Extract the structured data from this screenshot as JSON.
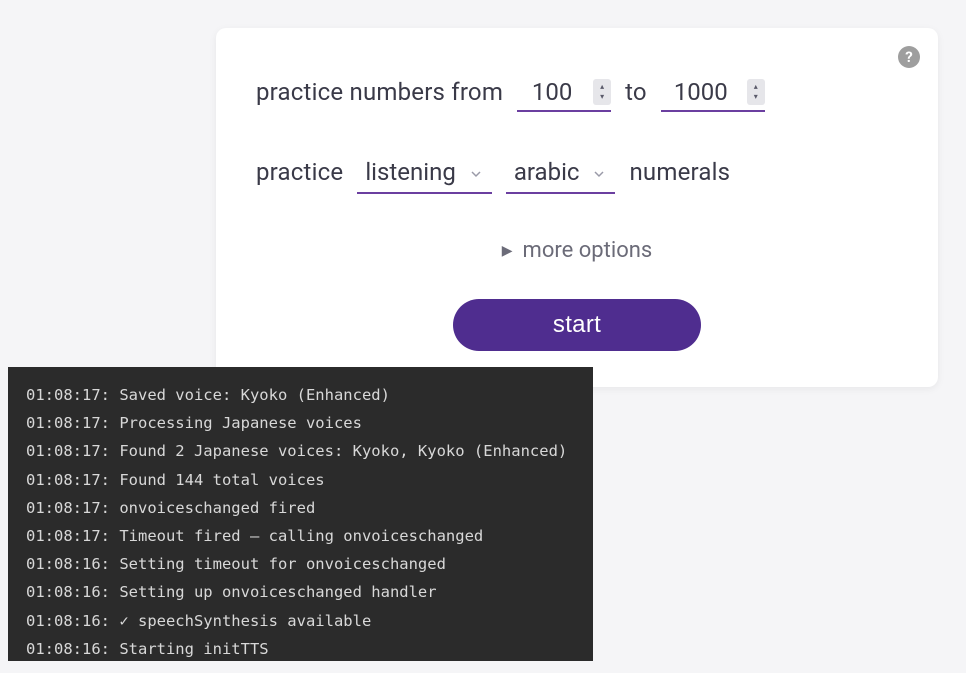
{
  "form": {
    "row1_prefix": "practice numbers from",
    "from_value": "100",
    "middle": "to",
    "to_value": "1000",
    "row2_prefix": "practice",
    "mode_value": "listening",
    "script_value": "arabic",
    "row2_suffix": "numerals",
    "more_options": "more options",
    "start_label": "start",
    "help_char": "?"
  },
  "logs": [
    "01:08:17: Saved voice: Kyoko (Enhanced)",
    "01:08:17: Processing Japanese voices",
    "01:08:17: Found 2 Japanese voices: Kyoko, Kyoko (Enhanced)",
    "01:08:17: Found 144 total voices",
    "01:08:17: onvoiceschanged fired",
    "01:08:17: Timeout fired – calling onvoiceschanged",
    "01:08:16: Setting timeout for onvoiceschanged",
    "01:08:16: Setting up onvoiceschanged handler",
    "01:08:16: ✓ speechSynthesis available",
    "01:08:16: Starting initTTS"
  ]
}
